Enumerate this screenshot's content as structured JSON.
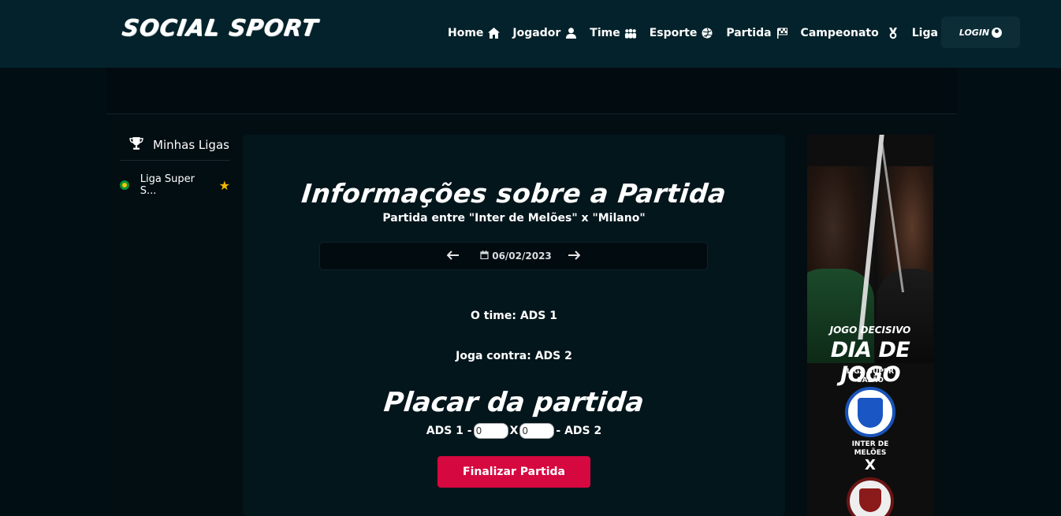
{
  "brand": "SOCIAL SPORT",
  "nav": {
    "items": [
      {
        "label": "Home",
        "icon": "home-icon"
      },
      {
        "label": "Jogador",
        "icon": "user-icon"
      },
      {
        "label": "Time",
        "icon": "users-icon"
      },
      {
        "label": "Esporte",
        "icon": "volleyball-icon"
      },
      {
        "label": "Partida",
        "icon": "flag-checkered-icon"
      },
      {
        "label": "Campeonato",
        "icon": "medal-icon"
      },
      {
        "label": "Liga",
        "icon": "trophy-icon"
      }
    ],
    "login_label": "LOGIN"
  },
  "sidebar": {
    "title": "Minhas Ligas",
    "leagues": [
      {
        "label": "Liga Super S...",
        "favorite": true
      }
    ]
  },
  "match": {
    "title": "Informações sobre a Partida",
    "subtitle": "Partida entre \"Inter de Melões\" x \"Milano\"",
    "date": "06/02/2023",
    "team_line": "O time: ADS 1",
    "opponent_line": "Joga contra: ADS 2",
    "score_title": "Placar da partida",
    "home_label": "ADS 1 -",
    "separator": "X",
    "away_label": "- ADS 2",
    "home_score": "0",
    "away_score": "0",
    "finish_label": "Finalizar Partida"
  },
  "banner": {
    "small_text": "JOGO DECISIVO",
    "big_text": "DIA DE JOGO",
    "league": "LIGA SUPER SALÃO",
    "team": "INTER DE MELÕES",
    "vs": "X"
  },
  "colors": {
    "navbar_bg": "#04222b",
    "page_bg": "#010f14",
    "accent_button": "#d60840",
    "star": "#f5b800"
  }
}
